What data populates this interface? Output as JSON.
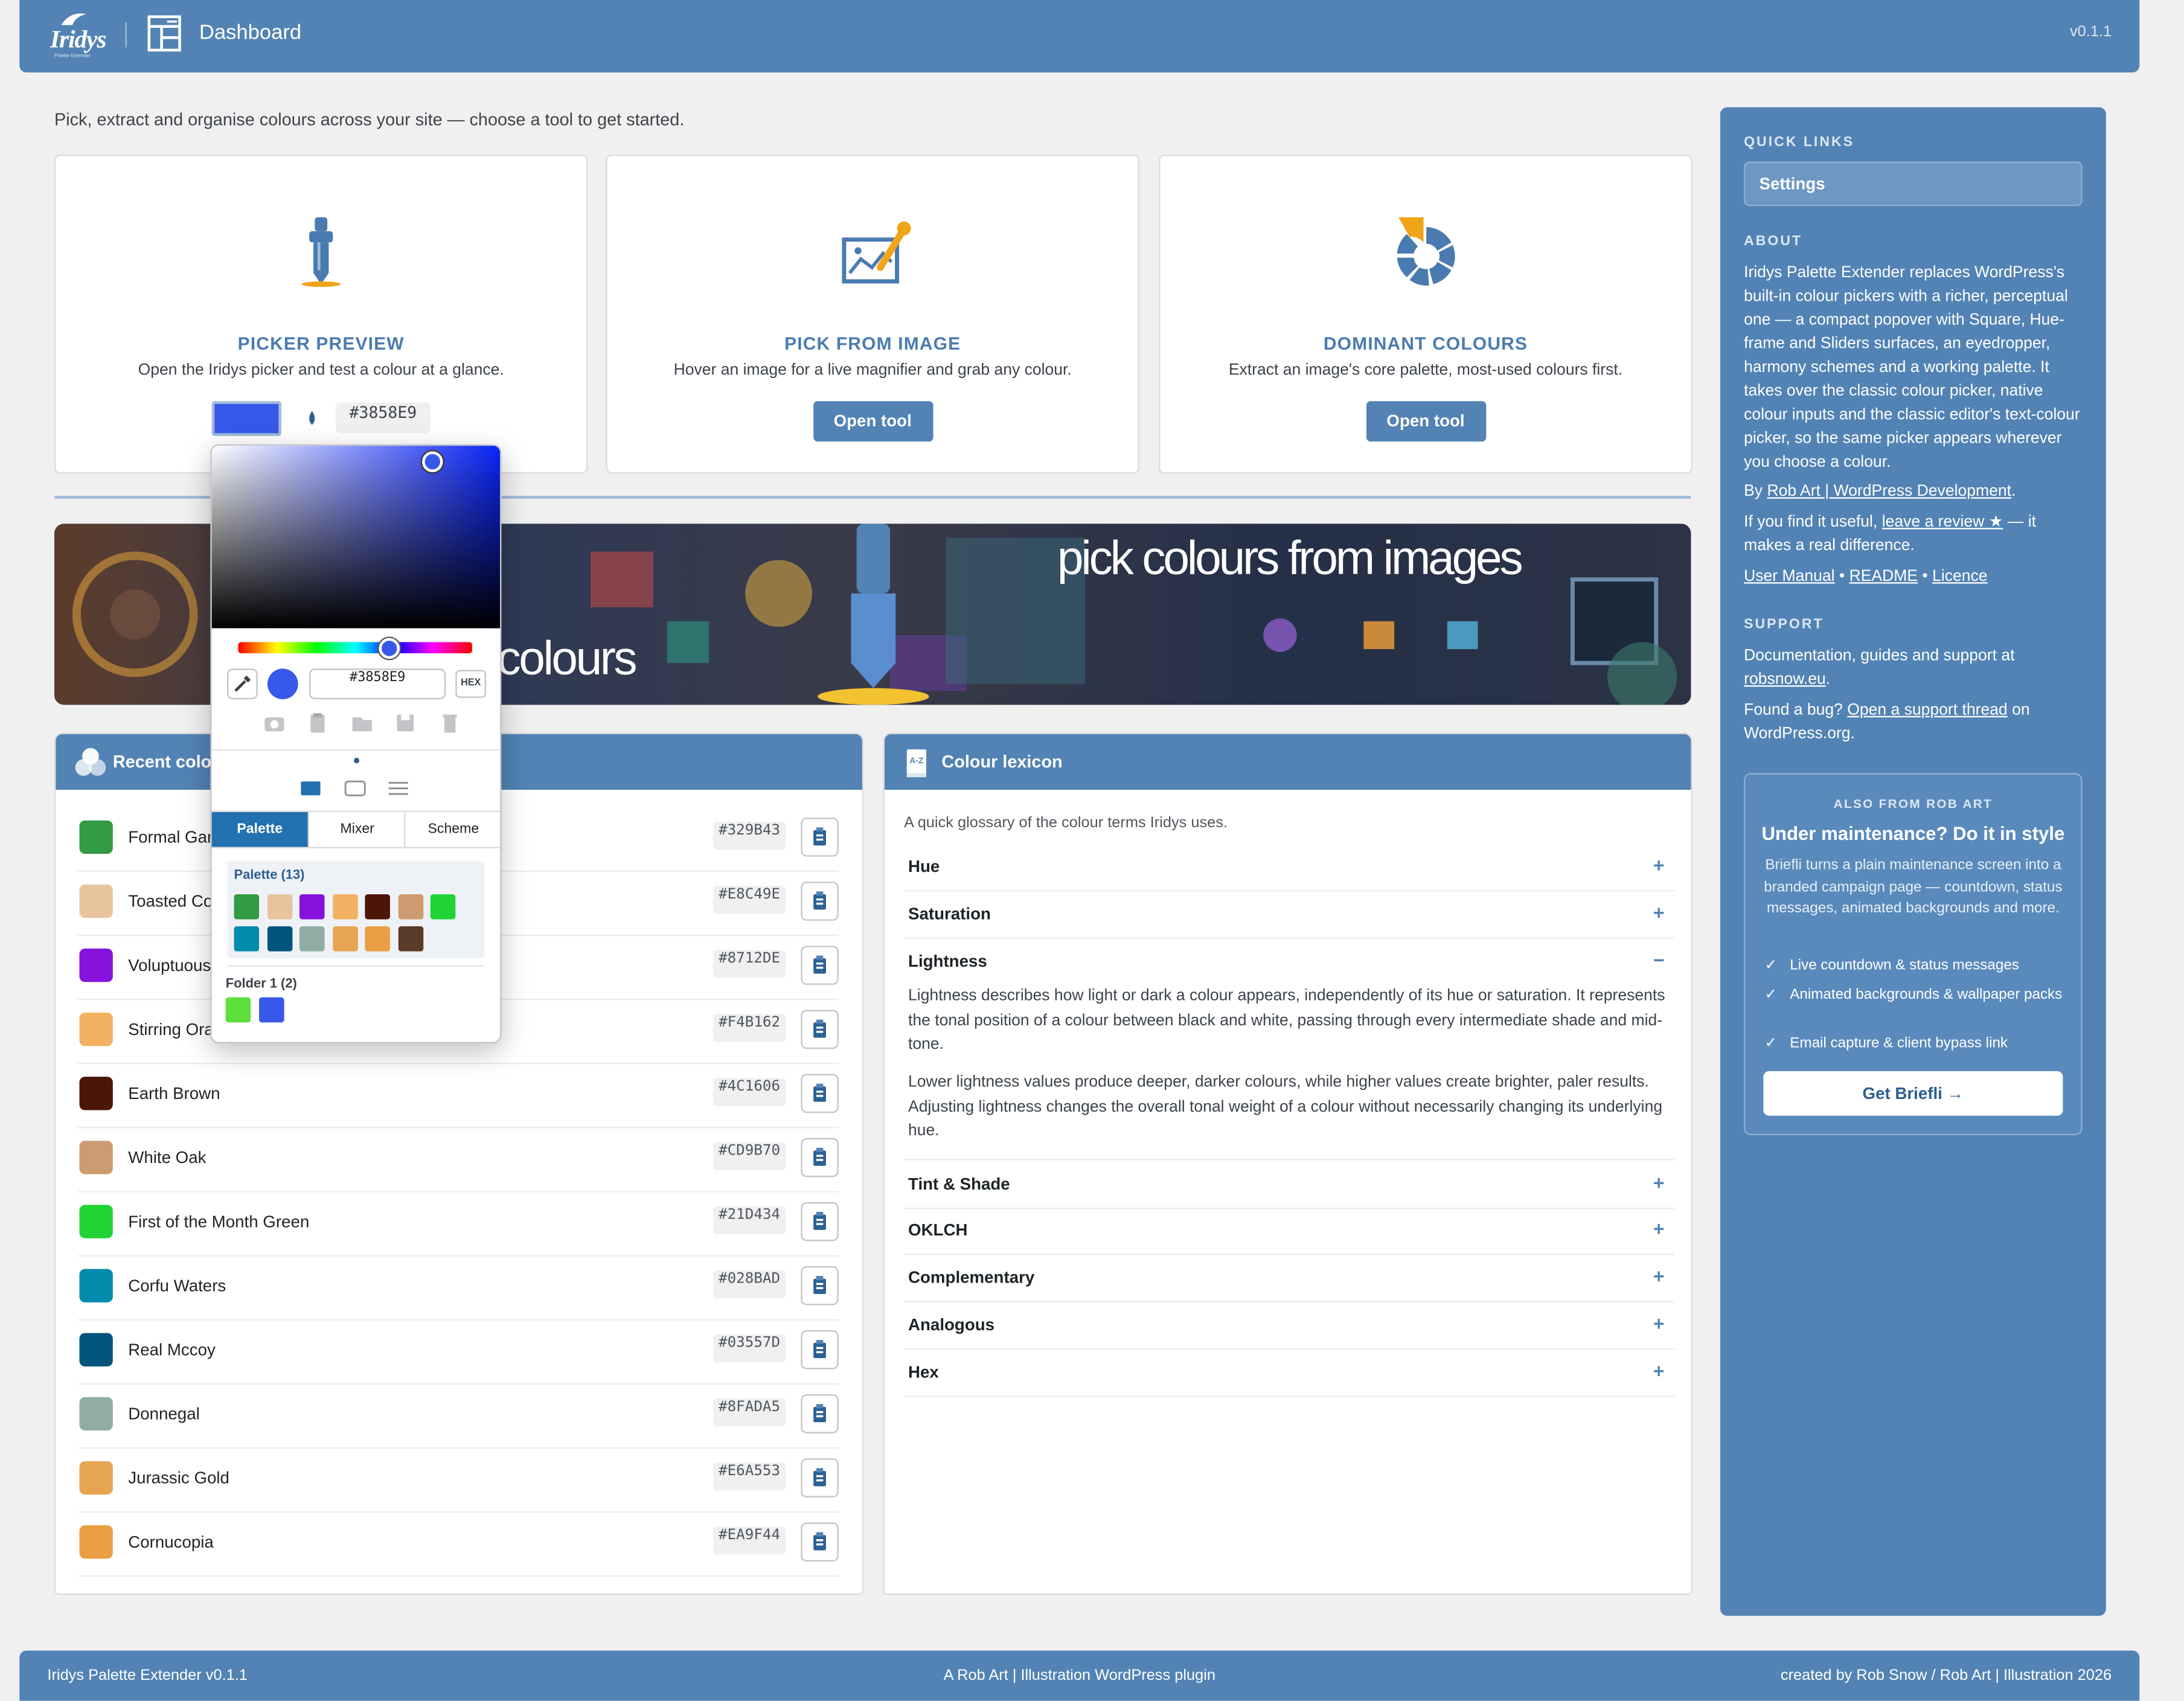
{
  "header": {
    "brand": "Iridys",
    "brand_sub": "Palette Extender",
    "title": "Dashboard",
    "version": "v0.1.1"
  },
  "intro": "Pick, extract and organise colours across your site — choose a tool to get started.",
  "tools": [
    {
      "title": "PICKER PREVIEW",
      "desc": "Open the Iridys picker and test a colour at a glance.",
      "hex": "#3858E9",
      "swatch": "#3858e9"
    },
    {
      "title": "PICK FROM IMAGE",
      "desc": "Hover an image for a live magnifier and grab any colour.",
      "button": "Open tool"
    },
    {
      "title": "DOMINANT COLOURS",
      "desc": "Extract an image's core palette, most-used colours first.",
      "button": "Open tool"
    }
  ],
  "banner": {
    "text_right": "pick colours from images",
    "text_left": "colours"
  },
  "recent": {
    "title": "Recent colours",
    "items": [
      {
        "name": "Formal Garden",
        "hex": "#329B43",
        "color": "#329b43"
      },
      {
        "name": "Toasted Coconut",
        "hex": "#E8C49E",
        "color": "#e8c49e"
      },
      {
        "name": "Voluptuous Violet",
        "hex": "#8712DE",
        "color": "#8712de"
      },
      {
        "name": "Stirring Orange",
        "hex": "#F4B162",
        "color": "#f4b162"
      },
      {
        "name": "Earth Brown",
        "hex": "#4C1606",
        "color": "#4c1606"
      },
      {
        "name": "White Oak",
        "hex": "#CD9B70",
        "color": "#cd9b70"
      },
      {
        "name": "First of the Month Green",
        "hex": "#21D434",
        "color": "#21d434"
      },
      {
        "name": "Corfu Waters",
        "hex": "#028BAD",
        "color": "#028bad"
      },
      {
        "name": "Real Mccoy",
        "hex": "#03557D",
        "color": "#03557d"
      },
      {
        "name": "Donnegal",
        "hex": "#8FADA5",
        "color": "#8fada5"
      },
      {
        "name": "Jurassic Gold",
        "hex": "#E6A553",
        "color": "#e6a553"
      },
      {
        "name": "Cornucopia",
        "hex": "#EA9F44",
        "color": "#ea9f44"
      }
    ]
  },
  "lexicon": {
    "title": "Colour lexicon",
    "intro": "A quick glossary of the colour terms Iridys uses.",
    "terms": [
      "Hue",
      "Saturation",
      "Lightness",
      "Tint & Shade",
      "OKLCH",
      "Complementary",
      "Analogous",
      "Hex"
    ],
    "lightness_p1": "Lightness describes how light or dark a colour appears, independently of its hue or saturation. It represents the tonal position of a colour between black and white, passing through every intermediate shade and mid-tone.",
    "lightness_p2": "Lower lightness values produce deeper, darker colours, while higher values create brighter, paler results. Adjusting lightness changes the overall tonal weight of a colour without necessarily changing its underlying hue.",
    "expand": "+",
    "collapse": "−"
  },
  "sidebar": {
    "quick_links_heading": "QUICK LINKS",
    "settings": "Settings",
    "about_heading": "ABOUT",
    "about_text": "Iridys Palette Extender replaces WordPress's built-in colour pickers with a richer, perceptual one — a compact popover with Square, Hue-frame and Sliders surfaces, an eyedropper, harmony schemes and a working palette. It takes over the classic colour picker, native colour inputs and the classic editor's text-colour picker, so the same picker appears wherever you choose a colour.",
    "by_prefix": "By ",
    "by_link": "Rob Art | WordPress Development",
    "review_prefix": "If you find it useful, ",
    "review_link": "leave a review ★",
    "review_suffix": " — it makes a real difference.",
    "links": [
      "User Manual",
      "README",
      "Licence"
    ],
    "link_sep": " • ",
    "support_heading": "SUPPORT",
    "support_text": "Documentation, guides and support at ",
    "support_link": "robsnow.eu",
    "bug_prefix": "Found a bug? ",
    "bug_link": "Open a support thread",
    "bug_suffix": " on WordPress.org.",
    "promo": {
      "eyebrow": "ALSO FROM ROB ART",
      "title": "Under maintenance? Do it in style",
      "desc": "Briefli turns a plain maintenance screen into a branded campaign page — countdown, status messages, animated backgrounds and more.",
      "features": [
        "Live countdown & status messages",
        "Animated backgrounds & wallpaper packs",
        "Email capture & client bypass link"
      ],
      "button": "Get Briefli →"
    }
  },
  "footer": {
    "left": "Iridys Palette Extender v0.1.1",
    "center": "A Rob Art | Illustration WordPress plugin",
    "right": "created by Rob Snow / Rob Art | Illustration 2026"
  },
  "picker": {
    "hex": "#3858E9",
    "format": "HEX",
    "tabs": [
      "Palette",
      "Mixer",
      "Scheme"
    ],
    "palette_title": "Palette (13)",
    "palette": [
      "#329b43",
      "#e8c49e",
      "#8712de",
      "#f4b162",
      "#4c1606",
      "#cd9b70",
      "#21d434",
      "#028bad",
      "#03557d",
      "#8fada5",
      "#e6a553",
      "#ea9f44",
      "#5a3a28"
    ],
    "folder_title": "Folder 1 (2)",
    "folder": [
      "#5de03b",
      "#3858e9"
    ]
  }
}
